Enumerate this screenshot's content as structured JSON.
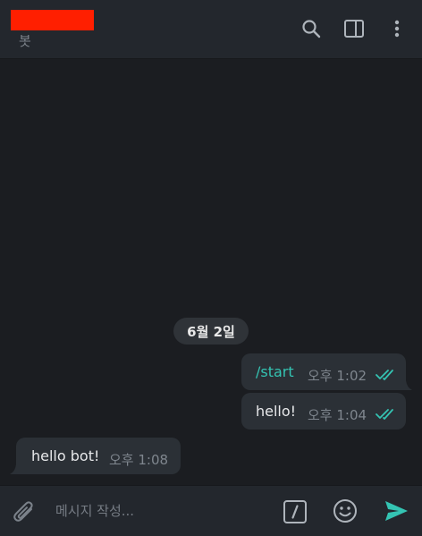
{
  "header": {
    "subtitle": "봇",
    "icons": {
      "search": "search-icon",
      "sidepanel": "side-panel-icon",
      "more": "more-vertical-icon"
    }
  },
  "chat": {
    "date_label": "6월 2일",
    "messages": [
      {
        "direction": "outgoing",
        "text": "/start",
        "time": "오후 1:02",
        "status": "read",
        "is_command": true
      },
      {
        "direction": "outgoing",
        "text": "hello!",
        "time": "오후 1:04",
        "status": "read"
      },
      {
        "direction": "incoming",
        "text": "hello bot!",
        "time": "오후 1:08"
      }
    ]
  },
  "composer": {
    "placeholder": "메시지 작성...",
    "value": "",
    "icons": {
      "attach": "paperclip-icon",
      "commands": "bot-command-icon",
      "emoji": "emoji-icon",
      "send": "send-icon"
    }
  },
  "colors": {
    "accent": "#34c4b3",
    "background": "#1b1d21",
    "bubble": "#2b3036",
    "header": "#23272d",
    "redacted": "#ff1f00"
  }
}
